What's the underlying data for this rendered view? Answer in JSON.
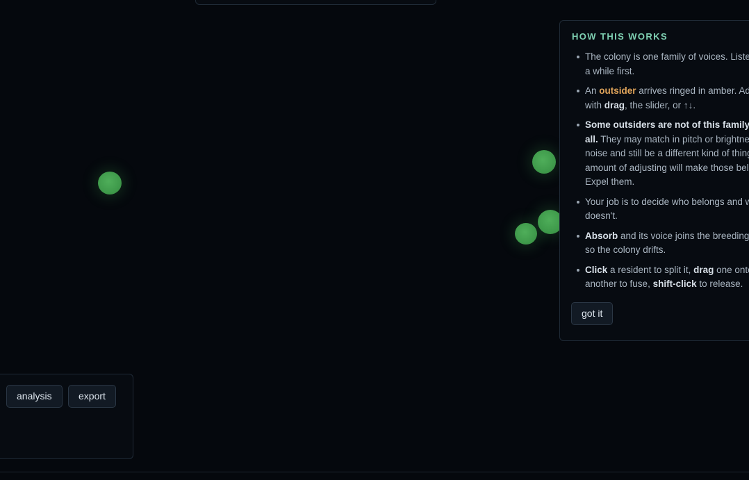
{
  "help": {
    "title": "HOW THIS WORKS",
    "items": [
      {
        "parts": [
          "The colony is one family of voices. Listen for a while first."
        ]
      },
      {
        "parts": [
          "An ",
          "outsider",
          " arrives ringed in amber. Adjust with ",
          "drag",
          ", the slider, or ↑↓."
        ]
      },
      {
        "parts": [
          "Some outsiders are not of this family at all.",
          " They may match in pitch or brightness or noise and still be a different kind of thing. No amount of adjusting will make those belong. Expel them."
        ]
      },
      {
        "parts": [
          "Your job is to decide who belongs and who doesn't."
        ]
      },
      {
        "parts": [
          "Absorb",
          " and its voice joins the breeding pool, so the colony drifts."
        ]
      },
      {
        "parts": [
          "Click",
          " a resident to split it, ",
          "drag",
          " one onto another to fuse, ",
          "shift-click",
          " to release."
        ]
      }
    ],
    "dismiss_label": "got it"
  },
  "controls": {
    "analysis_label": "analysis",
    "export_label": "export"
  },
  "colors": {
    "background": "#05080d",
    "panel": "#070b11",
    "accent_title": "#7fd1b3",
    "outsider_amber": "#e0a45a",
    "cell_green": "#4aa656"
  }
}
